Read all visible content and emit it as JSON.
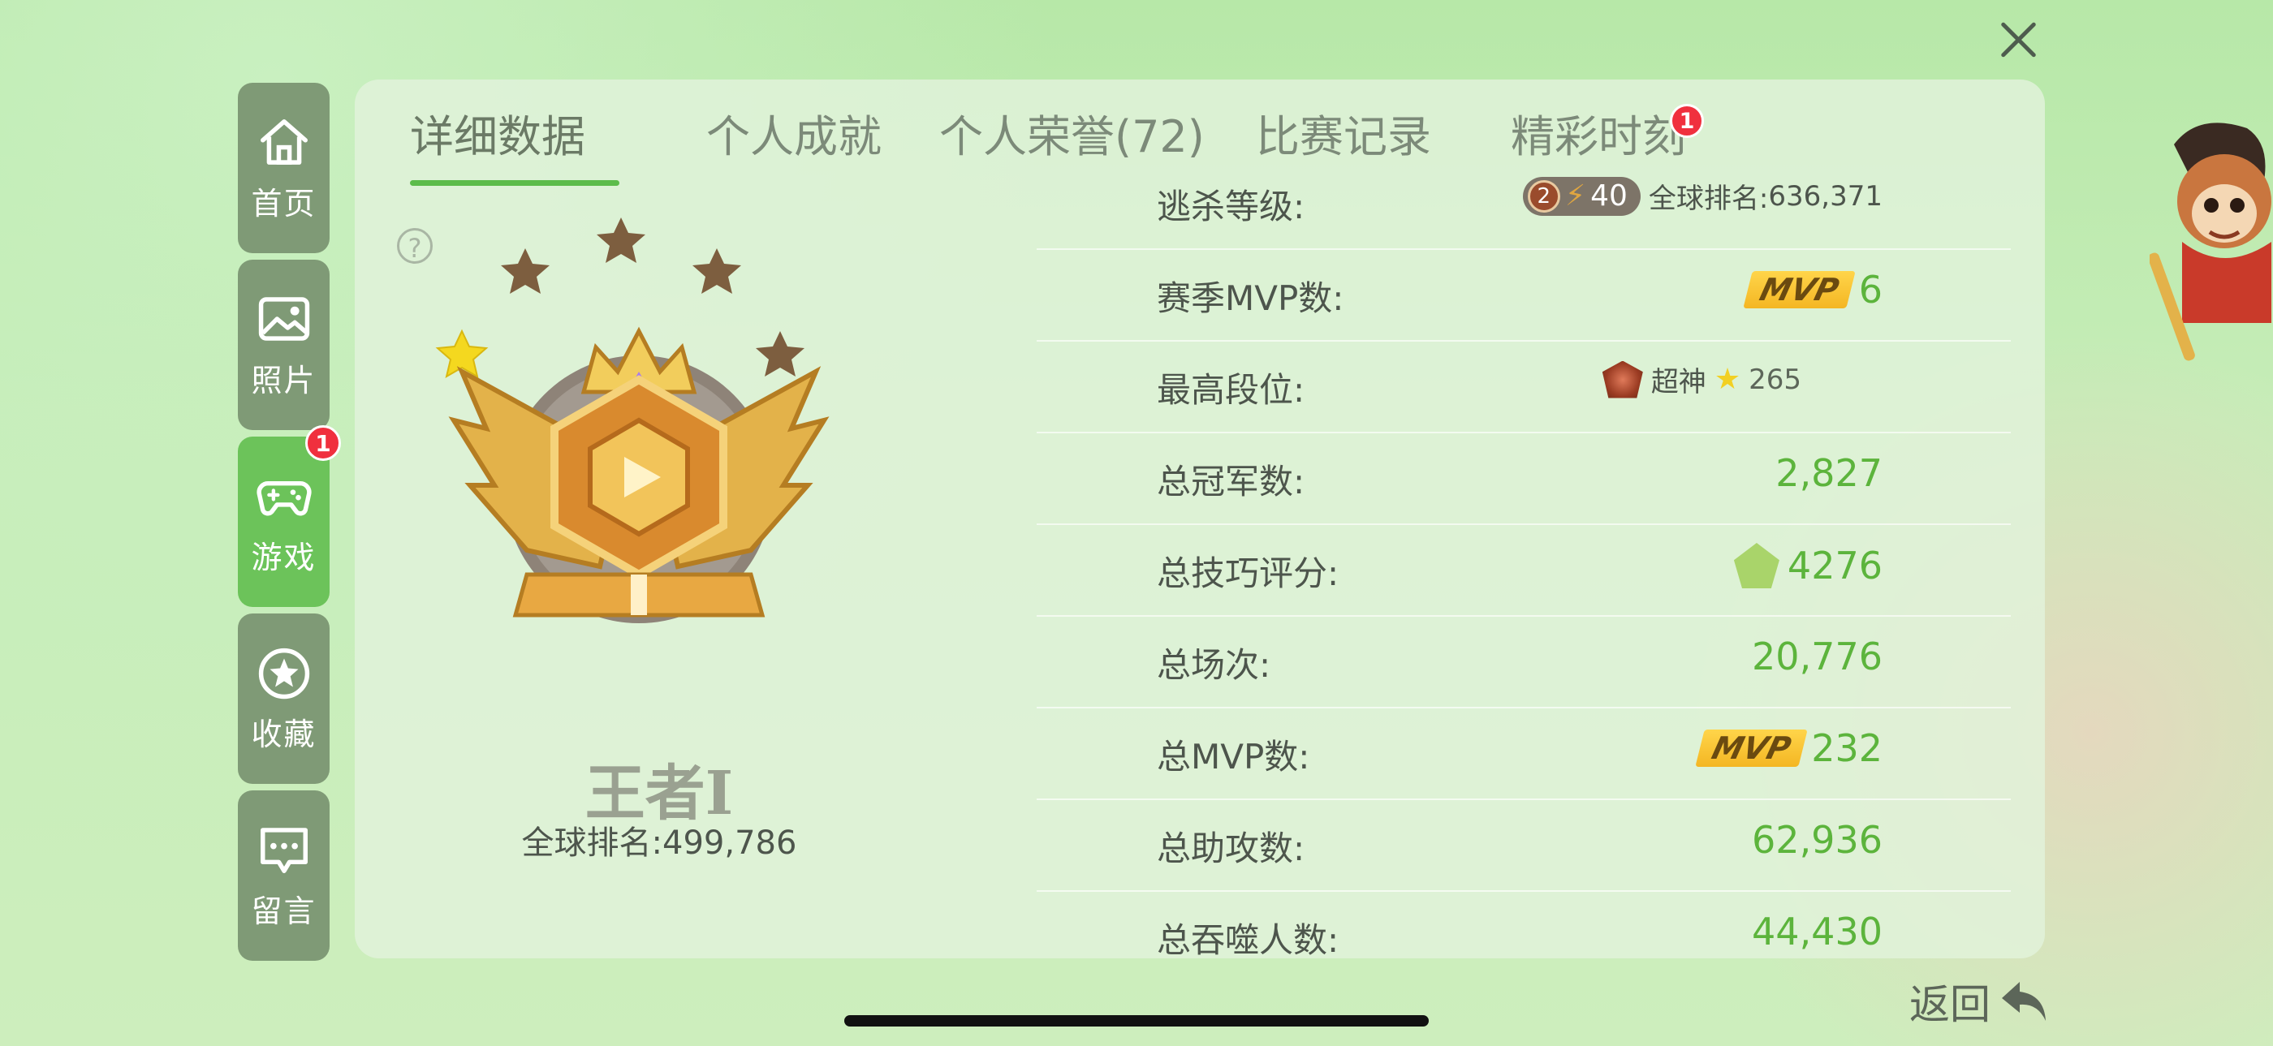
{
  "sidebar": {
    "items": [
      {
        "label": "首页",
        "icon": "home-icon"
      },
      {
        "label": "照片",
        "icon": "photo-icon"
      },
      {
        "label": "游戏",
        "icon": "gamepad-icon",
        "badge": "1"
      },
      {
        "label": "收藏",
        "icon": "star-icon"
      },
      {
        "label": "留言",
        "icon": "message-icon"
      }
    ]
  },
  "tabs": [
    {
      "label": "详细数据"
    },
    {
      "label": "个人成就"
    },
    {
      "label": "个人荣誉(72)"
    },
    {
      "label": "比赛记录"
    },
    {
      "label": "精彩时刻",
      "badge": "1"
    }
  ],
  "rank": {
    "name": "王者Ⅰ",
    "global_rank_label": "全球排名:",
    "global_rank_value": "499,786",
    "stars_filled": 1,
    "stars_total": 5
  },
  "stats": {
    "escape_level": {
      "label": "逃杀等级:",
      "tier": "2",
      "level": "40",
      "rank_label": "全球排名:",
      "rank_value": "636,371"
    },
    "season_mvp": {
      "label": "赛季MVP数:",
      "badge": "MVP",
      "value": "6"
    },
    "highest_rank": {
      "label": "最高段位:",
      "rank_name": "超神",
      "stars": "265"
    },
    "total_champion": {
      "label": "总冠军数:",
      "value": "2,827"
    },
    "skill_score": {
      "label": "总技巧评分:",
      "value": "4276"
    },
    "total_games": {
      "label": "总场次:",
      "value": "20,776"
    },
    "total_mvp": {
      "label": "总MVP数:",
      "badge": "MVP",
      "value": "232"
    },
    "total_assists": {
      "label": "总助攻数:",
      "value": "62,936"
    },
    "total_devour": {
      "label": "总吞噬人数:",
      "value": "44,430"
    }
  },
  "back_label": "返回",
  "colors": {
    "accent_green": "#5cb43c",
    "sidebar_bg": "#7f9a76",
    "sidebar_active": "#6cc35a",
    "badge_red": "#f0303e",
    "mvp_gold": "#f4b623"
  }
}
